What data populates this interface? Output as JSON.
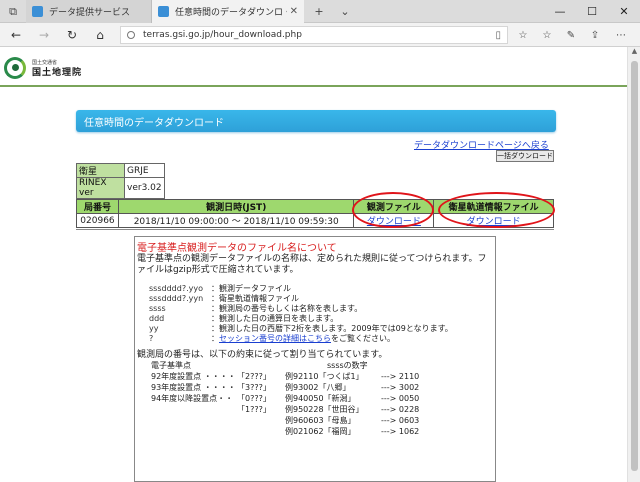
{
  "browser": {
    "tabs": [
      {
        "label": "データ提供サービス",
        "active": false
      },
      {
        "label": "任意時間のデータダウンロ・",
        "active": true
      }
    ],
    "url": "terras.gsi.go.jp/hour_download.php"
  },
  "header": {
    "org_small": "国土交通省",
    "org_name": "国土地理院"
  },
  "page": {
    "title": "任意時間のデータダウンロード",
    "back_link": "データダウンロードページへ戻る",
    "bulk_button": "一括ダウンロード"
  },
  "info": {
    "satellite_label": "衛星",
    "satellite_value": "GRJE",
    "rinex_label": "RINEX ver",
    "rinex_value": "ver3.02"
  },
  "table": {
    "headers": [
      "局番号",
      "観測日時(JST)",
      "観測ファイル",
      "衛星軌道情報ファイル"
    ],
    "rows": [
      {
        "station": "020966",
        "datetime": "2018/11/10 09:00:00 ～ 2018/11/10 09:59:30",
        "obs_link": "ダウンロード",
        "nav_link": "ダウンロード"
      }
    ]
  },
  "note": {
    "title": "電子基準点観測データのファイル名について",
    "intro": "電子基準点の観測データファイルの名称は、定められた規則に従ってつけられます。ファイルはgzip形式で圧縮されています。",
    "formats": [
      {
        "code": "sssdddd?.yyo",
        "desc": "：観測データファイル"
      },
      {
        "code": "sssdddd?.yyn",
        "desc": "：衛星軌道情報ファイル"
      },
      {
        "code": "ssss",
        "desc": "：観測局の番号もしくは名称を表します。"
      },
      {
        "code": "ddd",
        "desc": "：観測した日の通算日を表します。"
      },
      {
        "code": "yy",
        "desc": "：観測した日の西暦下2桁を表します。2009年では09となります。"
      }
    ],
    "session_prefix": "：",
    "session_code": "?",
    "session_link": "セッション番号の詳細はこちら",
    "session_suffix": "をご覧ください。",
    "rule_intro": "観測局の番号は、以下の約束に従って割り当てられています。",
    "col_header_left": "電子基準点",
    "col_header_right": "ssssの数字",
    "numbering": [
      {
        "label": "92年度設置点 ・・・・",
        "pattern": "「2???」",
        "example": "例92110「つくば1」",
        "result": "---> 2110"
      },
      {
        "label": "93年度設置点 ・・・・",
        "pattern": "「3???」",
        "example": "例93002「八郷」",
        "result": "---> 3002"
      },
      {
        "label": "94年度以降設置点・・",
        "pattern": "「0???」",
        "example": "例940050「新潟」",
        "result": "---> 0050"
      },
      {
        "label": "",
        "pattern": "「1???」",
        "example": "例950228「世田谷」",
        "result": "---> 0228"
      },
      {
        "label": "",
        "pattern": "",
        "example": "例960603「母島」",
        "result": "---> 0603"
      },
      {
        "label": "",
        "pattern": "",
        "example": "例021062「福岡」",
        "result": "---> 1062"
      }
    ]
  },
  "colors": {
    "title_bar": "#2ea0d8",
    "table_header": "#9ed86e",
    "highlight": "#e0141a",
    "link": "#1a3fd0"
  }
}
